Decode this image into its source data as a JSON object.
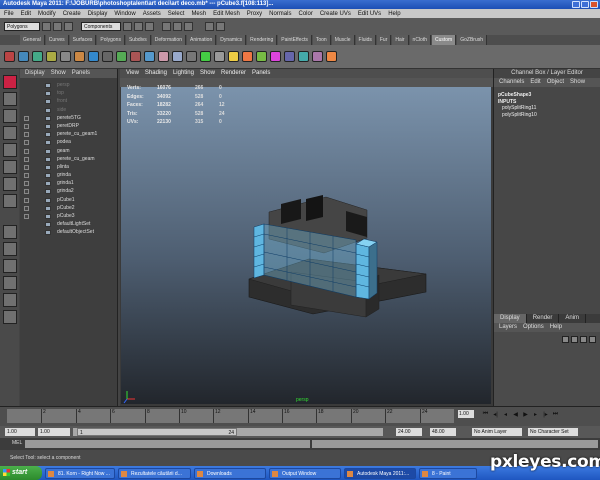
{
  "window": {
    "title": "Autodesk Maya 2011: F:\\JOBURB\\photoshoptalent\\art deci\\art deco.mb*  ---  pCube3.f[108:113]..."
  },
  "menubar": {
    "items": [
      "File",
      "Edit",
      "Modify",
      "Create",
      "Display",
      "Window",
      "Assets",
      "Select",
      "Mesh",
      "Edit Mesh",
      "Proxy",
      "Normals",
      "Color",
      "Create UVs",
      "Edit UVs",
      "Help"
    ]
  },
  "statusline": {
    "mode": "Polygons",
    "selection_mode": "Components"
  },
  "shelf": {
    "tabs": [
      "General",
      "Curves",
      "Surfaces",
      "Polygons",
      "Subdivs",
      "Deformation",
      "Animation",
      "Dynamics",
      "Rendering",
      "PaintEffects",
      "Toon",
      "Muscle",
      "Fluids",
      "Fur",
      "Hair",
      "nCloth",
      "Custom",
      "GoZBrush"
    ],
    "active_tab": "Custom"
  },
  "outliner": {
    "menu": [
      "Display",
      "Show",
      "Panels"
    ],
    "items": [
      {
        "label": "persp",
        "dim": true
      },
      {
        "label": "top",
        "dim": true
      },
      {
        "label": "front",
        "dim": true
      },
      {
        "label": "side",
        "dim": true
      },
      {
        "label": "perete5TG",
        "dim": false
      },
      {
        "label": "peretDRP",
        "dim": false
      },
      {
        "label": "perete_cu_geam1",
        "dim": false
      },
      {
        "label": "podea",
        "dim": false
      },
      {
        "label": "geam",
        "dim": false
      },
      {
        "label": "perete_cu_geam",
        "dim": false
      },
      {
        "label": "plinta",
        "dim": false
      },
      {
        "label": "grinda",
        "dim": false
      },
      {
        "label": "grinda1",
        "dim": false
      },
      {
        "label": "grinda2",
        "dim": false
      },
      {
        "label": "pCube1",
        "dim": false
      },
      {
        "label": "pCube2",
        "dim": false
      },
      {
        "label": "pCube3",
        "dim": false
      },
      {
        "label": "defaultLightSet",
        "dim": false
      },
      {
        "label": "defaultObjectSet",
        "dim": false
      }
    ]
  },
  "viewport": {
    "menu": [
      "View",
      "Shading",
      "Lighting",
      "Show",
      "Renderer",
      "Panels"
    ],
    "stats": [
      {
        "label": "Verts:",
        "a": "16076",
        "b": "266",
        "c": "0"
      },
      {
        "label": "Edges:",
        "a": "34092",
        "b": "528",
        "c": "0"
      },
      {
        "label": "Faces:",
        "a": "18282",
        "b": "264",
        "c": "12"
      },
      {
        "label": "Tris:",
        "a": "33220",
        "b": "528",
        "c": "24"
      },
      {
        "label": "UVs:",
        "a": "22130",
        "b": "315",
        "c": "0"
      }
    ],
    "camera": "persp"
  },
  "channelbox": {
    "title": "Channel Box / Layer Editor",
    "menu": [
      "Channels",
      "Edit",
      "Object",
      "Show"
    ],
    "shape": "pCubeShape3",
    "inputs_label": "INPUTS",
    "inputs": [
      "polySplitRing11",
      "polySplitRing10"
    ]
  },
  "layers": {
    "tabs": [
      "Display",
      "Render",
      "Anim"
    ],
    "active_tab": "Display",
    "menu": [
      "Layers",
      "Options",
      "Help"
    ]
  },
  "timeslider": {
    "ticks": [
      "2",
      "4",
      "6",
      "8",
      "10",
      "12",
      "14",
      "16",
      "18",
      "20",
      "22",
      "24"
    ],
    "current_frame": "1.00",
    "playback_glyphs": [
      "⏮",
      "◂|",
      "◂",
      "◀",
      "▶",
      "▸",
      "|▸",
      "⏭"
    ]
  },
  "rangebar": {
    "start": "1.00",
    "start2": "1.00",
    "slider_start": "1",
    "slider_end": "24",
    "end": "24.00",
    "end2": "48.00",
    "anim_layer": "No Anim Layer",
    "character_set": "No Character Set"
  },
  "mel": {
    "label": "MEL"
  },
  "helpline": {
    "text": "Select Tool: select a component"
  },
  "taskbar": {
    "start": "start",
    "tasks": [
      {
        "label": "81. Korn - Right Now ...",
        "active": false
      },
      {
        "label": "Rezultatele căutării d...",
        "active": false
      },
      {
        "label": "Downloads",
        "active": false
      },
      {
        "label": "Output Window",
        "active": false
      },
      {
        "label": "Autodesk Maya 2011:...",
        "active": true
      },
      {
        "label": "8 - Paint",
        "active": false
      }
    ]
  },
  "watermark": "pxleyes.com",
  "colors": {
    "viewport_top": "#7b93ac",
    "viewport_bottom": "#22262c",
    "selected_faces": "#66c7ef",
    "taskbar": "#2f66d0"
  }
}
